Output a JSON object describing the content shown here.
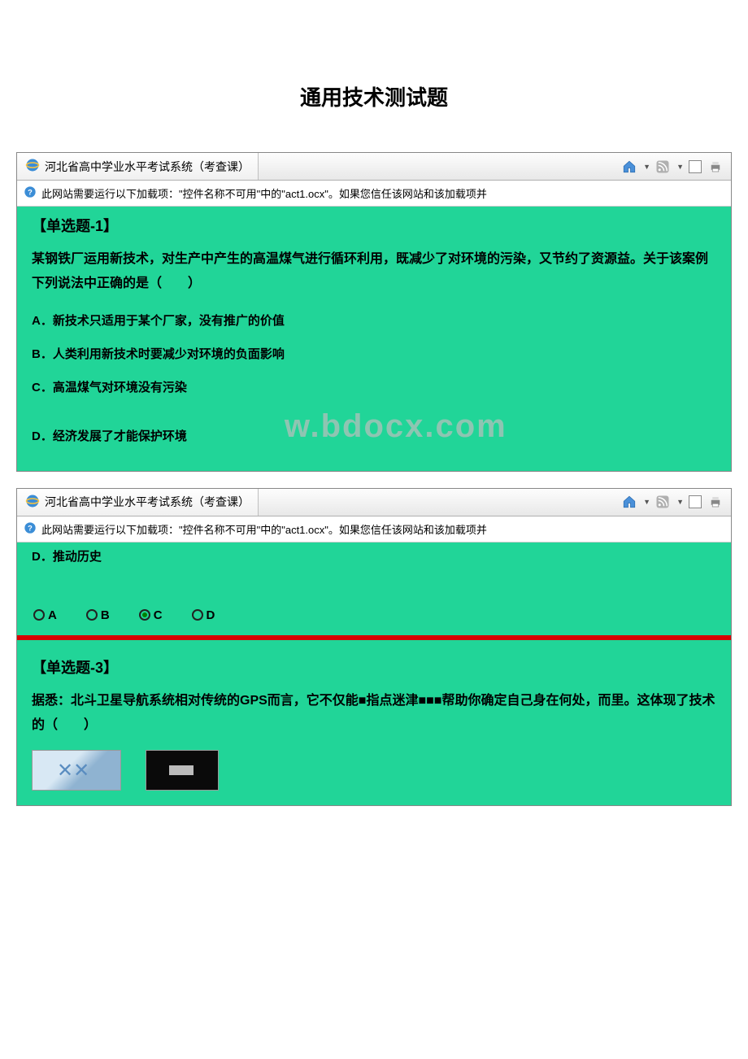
{
  "page_title": "通用技术测试题",
  "screenshot1": {
    "tab_title": "河北省高中学业水平考试系统（考查课）",
    "info_bar": "此网站需要运行以下加载项：\"控件名称不可用\"中的\"act1.ocx\"。如果您信任该网站和该加载项并",
    "question_header": "【单选题-1】",
    "question_text": "某钢铁厂运用新技术，对生产中产生的高温煤气进行循环利用，既减少了对环境的污染，又节约了资源益。关于该案例下列说法中正确的是（　　）",
    "options": {
      "a": "A．新技术只适用于某个厂家，没有推广的价值",
      "b": "B．人类利用新技术时要减少对环境的负面影响",
      "c": "C．高温煤气对环境没有污染",
      "d": "D．经济发展了才能保护环境"
    }
  },
  "watermark": "w.bdocx.com",
  "screenshot2": {
    "tab_title": "河北省高中学业水平考试系统（考查课）",
    "info_bar": "此网站需要运行以下加载项：\"控件名称不可用\"中的\"act1.ocx\"。如果您信任该网站和该加载项并",
    "prev_option_d": "D．推动历史",
    "radio_options": [
      "A",
      "B",
      "C",
      "D"
    ],
    "radio_selected": "C",
    "question_header": "【单选题-3】",
    "question_text": "据悉：北斗卫星导航系统相对传统的GPS而言，它不仅能■指点迷津■■■帮助你确定自己身在何处，而里。这体现了技术的（　　）"
  }
}
